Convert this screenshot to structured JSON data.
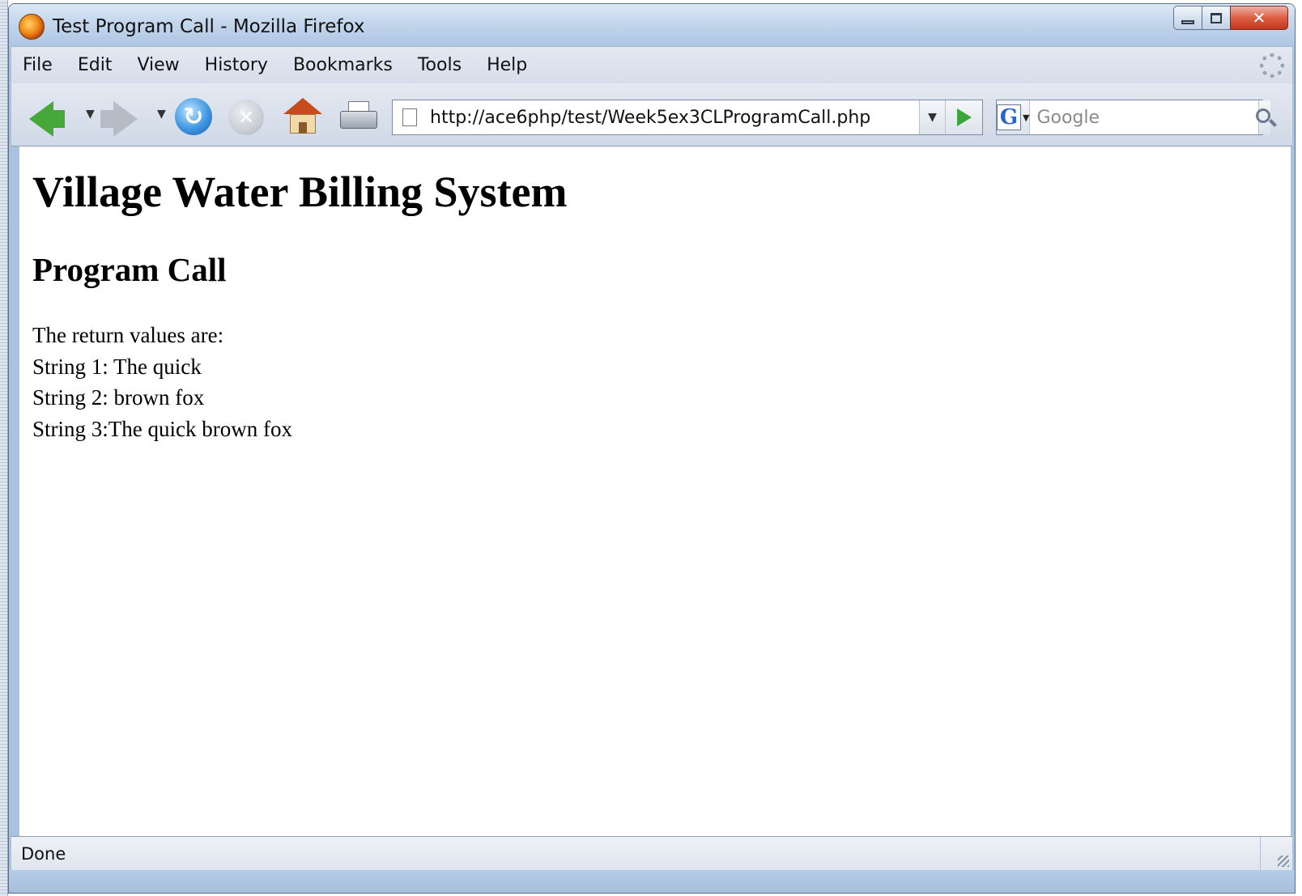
{
  "window": {
    "title": "Test Program Call - Mozilla Firefox"
  },
  "menu": {
    "items": [
      "File",
      "Edit",
      "View",
      "History",
      "Bookmarks",
      "Tools",
      "Help"
    ]
  },
  "navigation": {
    "url": "http://ace6php/test/Week5ex3CLProgramCall.php",
    "search_placeholder": "Google",
    "engine_letter": "G"
  },
  "page": {
    "heading": "Village Water Billing System",
    "subheading": "Program Call",
    "lines": [
      "The return values are:",
      "String 1: The quick",
      "String 2: brown fox",
      "String 3:The quick brown fox"
    ]
  },
  "status": {
    "text": "Done"
  },
  "colors": {
    "back_arrow": "#47a83a",
    "go_arrow": "#3aa53a",
    "close_button": "#c2361c"
  },
  "icons": {
    "app": "firefox-icon",
    "back": "back-arrow-icon",
    "forward": "forward-arrow-icon",
    "reload": "reload-icon",
    "stop": "stop-icon",
    "home": "home-icon",
    "print": "print-icon",
    "go": "go-arrow-icon",
    "search": "magnifier-icon"
  }
}
